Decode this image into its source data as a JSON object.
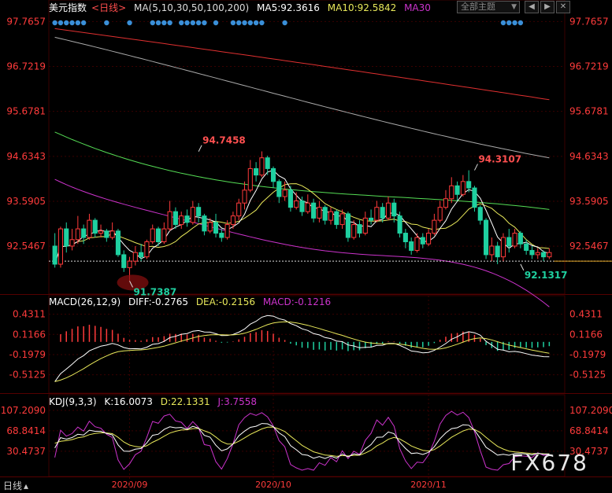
{
  "header": {
    "name": "美元指数",
    "period": "<日线>",
    "ma_label": "MA(5,10,30,50,100,200)",
    "ma5": "MA5:92.3616",
    "ma10": "MA10:92.5842",
    "ma30": "MA30",
    "theme": "全部主题",
    "close_glyph": "✕"
  },
  "macd_header": {
    "label": "MACD(26,12,9)",
    "diff": "DIFF:-0.2765",
    "dea": "DEA:-0.2156",
    "macd": "MACD:-0.1216"
  },
  "kdj_header": {
    "label": "KDJ(9,3,3)",
    "k": "K:16.0073",
    "d": "D:22.1331",
    "j": "J:3.7558"
  },
  "bottom": {
    "period_label": "日线"
  },
  "watermark": "FX678",
  "colors": {
    "up": "#ff3b3b",
    "down": "#1fd0a0",
    "ma5": "#ffffff",
    "ma10": "#e8e85a",
    "ma30": "#cc33cc",
    "ma50": "#55dd55",
    "ma100": "#aaaaaa",
    "ma200": "#e03030",
    "axis": "#ff3b3b",
    "grid": "#3a0000",
    "dot": "#3a8fd8"
  },
  "chart_data": [
    {
      "type": "candlestick",
      "y_ticks": [
        "97.7657",
        "96.7219",
        "95.6781",
        "94.6343",
        "93.5905",
        "92.5467"
      ],
      "ylim": [
        91.6,
        97.9
      ],
      "x_labels": [
        "2020/09",
        "2020/10",
        "2020/11"
      ],
      "annotations": [
        {
          "label": "94.7458",
          "x": 25,
          "y": 94.7458,
          "color": "#ff5050"
        },
        {
          "label": "94.3107",
          "x": 73,
          "y": 94.3107,
          "color": "#ff5050"
        },
        {
          "label": "91.7387",
          "x": 13,
          "y": 91.7387,
          "color": "#1fd0a0"
        },
        {
          "label": "92.1317",
          "x": 81,
          "y": 92.1317,
          "color": "#1fd0a0"
        }
      ],
      "reference_line": 92.2,
      "candles": [
        [
          92.55,
          92.13,
          92.85,
          92.05
        ],
        [
          92.13,
          92.95,
          93.0,
          92.05
        ],
        [
          92.95,
          92.55,
          93.1,
          92.4
        ],
        [
          92.55,
          92.7,
          92.95,
          92.45
        ],
        [
          92.7,
          92.95,
          93.25,
          92.6
        ],
        [
          92.95,
          92.75,
          93.05,
          92.6
        ],
        [
          92.75,
          93.15,
          93.3,
          92.7
        ],
        [
          93.15,
          92.85,
          93.2,
          92.75
        ],
        [
          92.85,
          92.9,
          93.05,
          92.75
        ],
        [
          92.9,
          92.75,
          92.95,
          92.65
        ],
        [
          92.75,
          92.9,
          93.1,
          92.7
        ],
        [
          92.9,
          92.35,
          92.95,
          92.3
        ],
        [
          92.35,
          92.05,
          92.45,
          91.95
        ],
        [
          92.05,
          92.2,
          92.3,
          91.74
        ],
        [
          92.2,
          92.4,
          92.55,
          92.1
        ],
        [
          92.4,
          92.3,
          92.6,
          92.2
        ],
        [
          92.3,
          92.65,
          92.7,
          92.25
        ],
        [
          92.65,
          92.95,
          93.05,
          92.6
        ],
        [
          92.95,
          92.65,
          93.0,
          92.55
        ],
        [
          92.65,
          92.95,
          93.1,
          92.6
        ],
        [
          92.95,
          93.35,
          93.6,
          92.9
        ],
        [
          93.35,
          93.05,
          93.45,
          92.95
        ],
        [
          93.05,
          93.25,
          93.35,
          92.95
        ],
        [
          93.25,
          93.1,
          93.4,
          93.0
        ],
        [
          93.1,
          93.45,
          93.6,
          93.05
        ],
        [
          93.45,
          93.25,
          93.55,
          93.1
        ],
        [
          93.25,
          92.9,
          93.3,
          92.8
        ],
        [
          92.9,
          93.1,
          93.2,
          92.85
        ],
        [
          93.1,
          92.85,
          93.3,
          92.75
        ],
        [
          92.85,
          92.75,
          92.95,
          92.65
        ],
        [
          92.75,
          93.05,
          93.15,
          92.7
        ],
        [
          93.05,
          93.25,
          93.35,
          92.95
        ],
        [
          93.25,
          93.55,
          93.65,
          93.15
        ],
        [
          93.55,
          93.85,
          94.05,
          93.4
        ],
        [
          93.85,
          94.35,
          94.55,
          93.8
        ],
        [
          94.35,
          94.2,
          94.5,
          94.05
        ],
        [
          94.2,
          94.6,
          94.75,
          94.15
        ],
        [
          94.6,
          94.35,
          94.65,
          94.2
        ],
        [
          94.35,
          94.05,
          94.4,
          93.9
        ],
        [
          94.05,
          93.7,
          94.1,
          93.55
        ],
        [
          93.7,
          93.85,
          94.05,
          93.6
        ],
        [
          93.85,
          93.45,
          93.95,
          93.35
        ],
        [
          93.45,
          93.6,
          93.8,
          93.4
        ],
        [
          93.6,
          93.35,
          93.7,
          93.25
        ],
        [
          93.35,
          93.55,
          93.75,
          93.3
        ],
        [
          93.55,
          93.2,
          93.65,
          93.1
        ],
        [
          93.2,
          93.45,
          93.6,
          93.1
        ],
        [
          93.45,
          93.15,
          93.5,
          93.05
        ],
        [
          93.15,
          93.35,
          93.45,
          93.05
        ],
        [
          93.35,
          93.05,
          93.4,
          92.95
        ],
        [
          93.05,
          93.3,
          93.4,
          92.95
        ],
        [
          93.3,
          92.75,
          93.35,
          92.65
        ],
        [
          92.75,
          93.05,
          93.15,
          92.7
        ],
        [
          93.05,
          92.85,
          93.15,
          92.75
        ],
        [
          92.85,
          93.2,
          93.35,
          92.8
        ],
        [
          93.2,
          93.15,
          93.4,
          93.05
        ],
        [
          93.15,
          93.45,
          93.6,
          93.1
        ],
        [
          93.45,
          93.2,
          93.55,
          93.1
        ],
        [
          93.2,
          93.55,
          93.7,
          93.15
        ],
        [
          93.55,
          93.25,
          93.65,
          93.1
        ],
        [
          93.25,
          92.85,
          93.35,
          92.75
        ],
        [
          92.85,
          92.65,
          92.95,
          92.5
        ],
        [
          92.65,
          92.45,
          92.75,
          92.35
        ],
        [
          92.45,
          92.75,
          92.85,
          92.4
        ],
        [
          92.75,
          92.6,
          92.85,
          92.5
        ],
        [
          92.6,
          92.85,
          92.95,
          92.55
        ],
        [
          92.85,
          93.15,
          93.3,
          92.8
        ],
        [
          93.15,
          93.45,
          93.6,
          93.1
        ],
        [
          93.45,
          93.65,
          93.85,
          93.4
        ],
        [
          93.65,
          93.95,
          94.15,
          93.55
        ],
        [
          93.95,
          93.75,
          94.05,
          93.6
        ],
        [
          93.75,
          94.05,
          94.2,
          93.7
        ],
        [
          94.05,
          93.9,
          94.31,
          93.8
        ],
        [
          93.9,
          93.45,
          93.95,
          93.35
        ],
        [
          93.45,
          93.15,
          93.5,
          93.05
        ],
        [
          93.15,
          92.35,
          93.2,
          92.25
        ],
        [
          92.35,
          92.55,
          92.75,
          92.2
        ],
        [
          92.55,
          92.3,
          92.65,
          92.13
        ],
        [
          92.3,
          92.75,
          92.85,
          92.2
        ],
        [
          92.75,
          92.55,
          92.95,
          92.4
        ],
        [
          92.55,
          92.85,
          92.95,
          92.5
        ],
        [
          92.85,
          92.6,
          92.9,
          92.5
        ],
        [
          92.6,
          92.45,
          92.7,
          92.35
        ],
        [
          92.45,
          92.35,
          92.55,
          92.25
        ],
        [
          92.35,
          92.4,
          92.5,
          92.25
        ],
        [
          92.4,
          92.3,
          92.45,
          92.2
        ],
        [
          92.3,
          92.4,
          92.5,
          92.25
        ]
      ]
    },
    {
      "type": "macd",
      "y_ticks": [
        "0.4311",
        "0.1166",
        "-0.1979",
        "-0.5125"
      ],
      "ylim": [
        -0.75,
        0.5
      ],
      "diff_last": -0.2765,
      "dea_last": -0.2156,
      "macd_last": -0.1216
    },
    {
      "type": "kdj",
      "y_ticks": [
        "107.2090",
        "68.8414",
        "30.4737"
      ],
      "ylim": [
        -8,
        110
      ],
      "k_last": 16.0073,
      "d_last": 22.1331,
      "j_last": 3.7558
    }
  ]
}
